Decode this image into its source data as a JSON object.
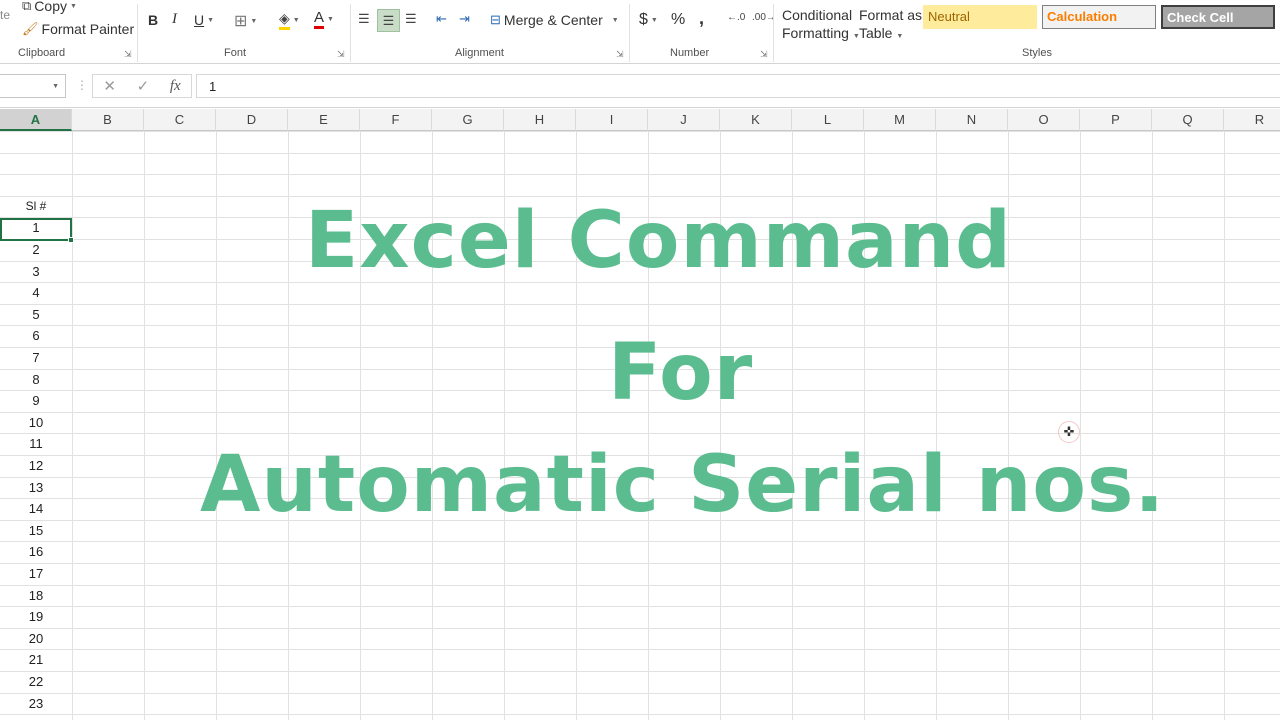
{
  "ribbon": {
    "clipboard": {
      "paste_fragment": "te",
      "copy": "Copy",
      "format_painter": "Format Painter",
      "label": "Clipboard"
    },
    "font": {
      "bold": "B",
      "italic": "I",
      "underline": "U",
      "font_color_letter": "A",
      "label": "Font"
    },
    "alignment": {
      "merge_center": "Merge & Center",
      "label": "Alignment"
    },
    "number": {
      "currency": "$",
      "percent": "%",
      "comma": ",",
      "label": "Number"
    },
    "styles": {
      "conditional_formatting_line1": "Conditional",
      "conditional_formatting_line2": "Formatting",
      "format_as_table_line1": "Format as",
      "format_as_table_line2": "Table",
      "neutral": "Neutral",
      "calculation": "Calculation",
      "check_cell": "Check Cell",
      "label": "Styles"
    }
  },
  "formula_bar": {
    "name_box": "",
    "cancel": "✕",
    "enter": "✓",
    "fx": "fx",
    "value": "1"
  },
  "columns": [
    "A",
    "B",
    "C",
    "D",
    "E",
    "F",
    "G",
    "H",
    "I",
    "J",
    "K",
    "L",
    "M",
    "N",
    "O",
    "P",
    "Q",
    "R"
  ],
  "active_column": "A",
  "cells": {
    "header": "Sl #",
    "serials": [
      "1",
      "2",
      "3",
      "4",
      "5",
      "6",
      "7",
      "8",
      "9",
      "10",
      "11",
      "12",
      "13",
      "14",
      "15",
      "16",
      "17",
      "18",
      "19",
      "20",
      "21",
      "22",
      "23"
    ]
  },
  "overlay": {
    "line1": "Excel Command",
    "line2": "For",
    "line3": "Automatic Serial nos."
  },
  "colors": {
    "accent": "#217346",
    "overlay_text": "#5bbd8f"
  }
}
